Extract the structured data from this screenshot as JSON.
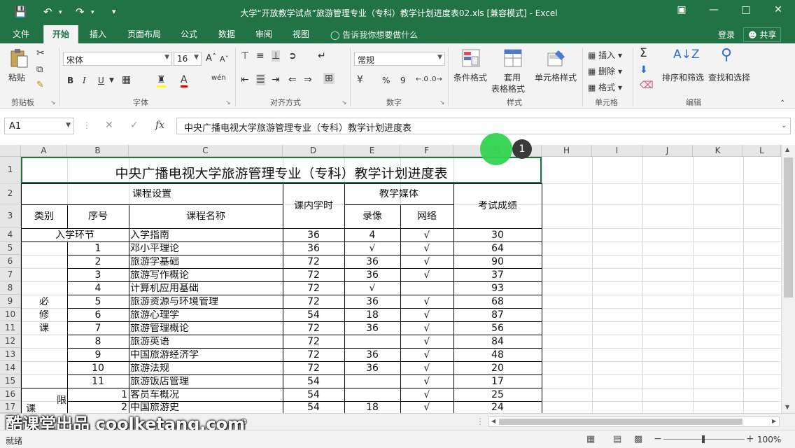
{
  "window": {
    "title": "大学“开放教学试点”旅游管理专业（专科）教学计划进度表02.xls  [兼容模式] - Excel",
    "save_icon": "save-icon",
    "undo_icon": "undo-icon",
    "redo_icon": "redo-icon"
  },
  "tabs": [
    "文件",
    "开始",
    "插入",
    "页面布局",
    "公式",
    "数据",
    "审阅",
    "视图"
  ],
  "tell_me": "告诉我你想要做什么",
  "account": {
    "login": "登录",
    "share": "共享"
  },
  "ribbon": {
    "clipboard": {
      "paste": "粘贴",
      "label": "剪贴板"
    },
    "font": {
      "name": "宋体",
      "size": "16",
      "bold": "B",
      "italic": "I",
      "underline": "U",
      "label": "字体"
    },
    "alignment": {
      "label": "对齐方式"
    },
    "number": {
      "format": "常规",
      "percent": "%",
      "comma": "9",
      "label": "数字"
    },
    "styles": {
      "conditional": "条件格式",
      "table_1": "套用",
      "table_2": "表格格式",
      "cell_styles": "单元格样式",
      "label": "样式"
    },
    "cells": {
      "insert": "插入",
      "delete": "删除",
      "format": "格式",
      "label": "单元格"
    },
    "editing": {
      "sort": "排序和筛选",
      "find": "查找和选择",
      "label": "编辑"
    }
  },
  "formula_bar": {
    "name_box": "A1",
    "fx": "fx",
    "content": "中央广播电视大学旅游管理专业（专科）教学计划进度表"
  },
  "columns": [
    "A",
    "B",
    "C",
    "D",
    "E",
    "F",
    "G",
    "H",
    "I",
    "J",
    "K",
    "L"
  ],
  "rows": [
    "1",
    "2",
    "3",
    "4",
    "5",
    "6",
    "7",
    "8",
    "9",
    "10",
    "11",
    "12",
    "13",
    "14",
    "15",
    "16",
    "17"
  ],
  "sheet": {
    "title": "中央广播电视大学旅游管理专业（专科）教学计划进度表",
    "hdr_course_setup": "课程设置",
    "hdr_hours": "课内学时",
    "hdr_media": "教学媒体",
    "hdr_score": "考试成绩",
    "hdr_category": "类别",
    "hdr_number": "序号",
    "hdr_course_name": "课程名称",
    "hdr_video": "录像",
    "hdr_network": "网络",
    "row4": {
      "a": "入学环节",
      "c": "入学指南",
      "d": "36",
      "e": "4",
      "f": "√",
      "g": "30"
    },
    "required_1": "必",
    "required_2": "修",
    "required_3": "课",
    "required_rows": [
      {
        "b": "1",
        "c": "邓小平理论",
        "d": "36",
        "e": "√",
        "f": "√",
        "g": "64"
      },
      {
        "b": "2",
        "c": "旅游学基础",
        "d": "72",
        "e": "36",
        "f": "√",
        "g": "90"
      },
      {
        "b": "3",
        "c": "旅游写作概论",
        "d": "72",
        "e": "36",
        "f": "√",
        "g": "37"
      },
      {
        "b": "4",
        "c": "计算机应用基础",
        "d": "72",
        "e": "√",
        "f": "",
        "g": "93"
      },
      {
        "b": "5",
        "c": "旅游资源与环境管理",
        "d": "72",
        "e": "36",
        "f": "√",
        "g": "68"
      },
      {
        "b": "6",
        "c": "旅游心理学",
        "d": "54",
        "e": "18",
        "f": "√",
        "g": "87"
      },
      {
        "b": "7",
        "c": "旅游管理概论",
        "d": "72",
        "e": "36",
        "f": "√",
        "g": "56"
      },
      {
        "b": "8",
        "c": "旅游英语",
        "d": "72",
        "e": "",
        "f": "√",
        "g": "84"
      },
      {
        "b": "9",
        "c": "中国旅游经济学",
        "d": "72",
        "e": "36",
        "f": "√",
        "g": "48"
      },
      {
        "b": "10",
        "c": "旅游法规",
        "d": "72",
        "e": "36",
        "f": "√",
        "g": "20"
      },
      {
        "b": "11",
        "c": "旅游饭店管理",
        "d": "54",
        "e": "",
        "f": "√",
        "g": "17"
      }
    ],
    "limited_1": "限",
    "limited_2": "课",
    "limited_rows": [
      {
        "b": "1",
        "c": "客员车概况",
        "d": "54",
        "e": "",
        "f": "√",
        "g": "25"
      },
      {
        "b": "2",
        "c": "中国旅游史",
        "d": "54",
        "e": "18",
        "f": "√",
        "g": "24"
      }
    ]
  },
  "marker_number": "1",
  "watermark": "酷课堂出品 coolketang.com",
  "status": {
    "ready": "就绪",
    "zoom": "100%"
  }
}
